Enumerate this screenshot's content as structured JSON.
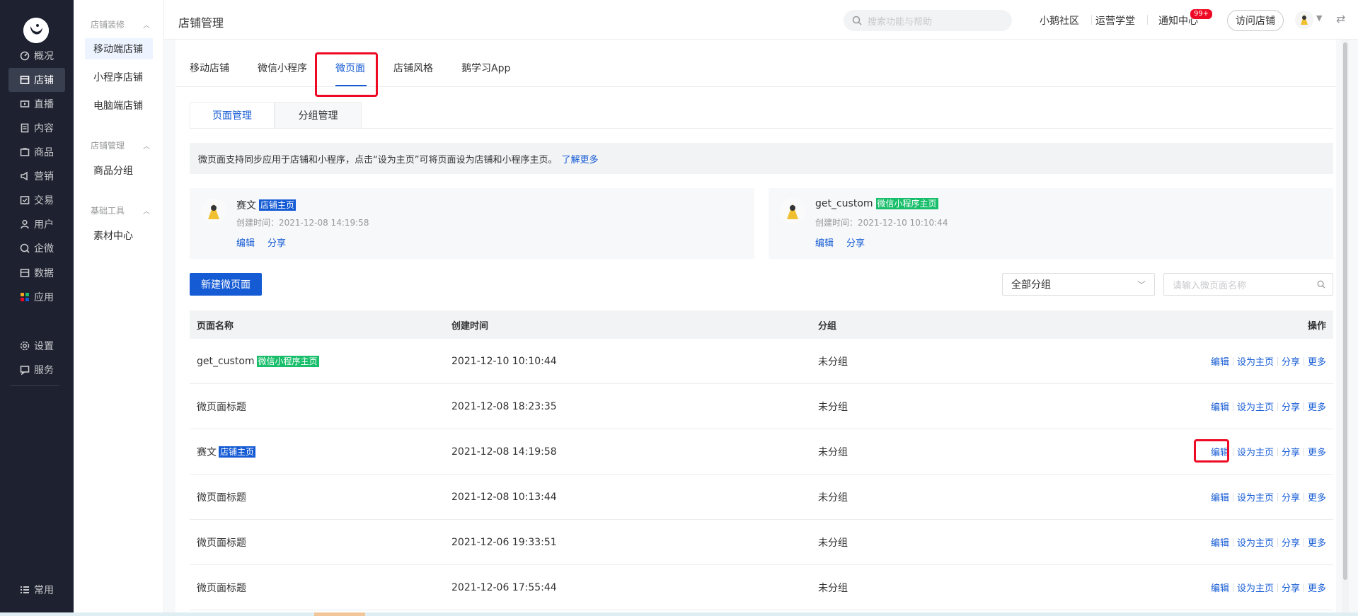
{
  "sidebar": {
    "items": [
      {
        "label": "概况",
        "icon": "overview-icon"
      },
      {
        "label": "店铺",
        "icon": "store-icon"
      },
      {
        "label": "直播",
        "icon": "live-icon"
      },
      {
        "label": "内容",
        "icon": "content-icon"
      },
      {
        "label": "商品",
        "icon": "goods-icon"
      },
      {
        "label": "营销",
        "icon": "marketing-icon"
      },
      {
        "label": "交易",
        "icon": "trade-icon"
      },
      {
        "label": "用户",
        "icon": "user-icon"
      },
      {
        "label": "企微",
        "icon": "wecom-icon"
      },
      {
        "label": "数据",
        "icon": "data-icon"
      },
      {
        "label": "应用",
        "icon": "apps-icon"
      },
      {
        "label": "设置",
        "icon": "settings-icon"
      },
      {
        "label": "服务",
        "icon": "service-icon"
      }
    ],
    "bottom": {
      "label": "常用",
      "icon": "list-icon"
    },
    "active_index": 1
  },
  "subnav": {
    "groups": [
      {
        "title": "店铺装修",
        "items": [
          "移动端店铺",
          "小程序店铺",
          "电脑端店铺"
        ]
      },
      {
        "title": "店铺管理",
        "items": [
          "商品分组"
        ]
      },
      {
        "title": "基础工具",
        "items": [
          "素材中心"
        ]
      }
    ],
    "active": "移动端店铺"
  },
  "header": {
    "title": "店铺管理",
    "search_placeholder": "搜索功能与帮助",
    "links": [
      "小鹅社区",
      "运营学堂",
      "通知中心"
    ],
    "notify_badge": "99+",
    "visit_store": "访问店铺"
  },
  "tabs": {
    "items": [
      "移动店铺",
      "微信小程序",
      "微页面",
      "店铺风格",
      "鹅学习App"
    ],
    "active": "微页面"
  },
  "subtabs": {
    "items": [
      "页面管理",
      "分组管理"
    ],
    "active": "页面管理"
  },
  "notice": {
    "text": "微页面支持同步应用于店铺和小程序，点击“设为主页”可将页面设为店铺和小程序主页。",
    "link": "了解更多"
  },
  "home_cards": [
    {
      "name": "赛文",
      "tag": "店铺主页",
      "tag_color": "#155bd4",
      "time": "创建时间：2021-12-08 14:19:58",
      "edit": "编辑",
      "share": "分享"
    },
    {
      "name": "get_custom",
      "tag": "微信小程序主页",
      "tag_color": "#19be6b",
      "time": "创建时间：2021-12-10 10:10:44",
      "edit": "编辑",
      "share": "分享"
    }
  ],
  "toolbar": {
    "new_page": "新建微页面",
    "group_select": "全部分组",
    "name_search_placeholder": "请输入微页面名称"
  },
  "table": {
    "headers": [
      "页面名称",
      "创建时间",
      "分组",
      "操作"
    ],
    "op_labels": [
      "编辑",
      "设为主页",
      "分享",
      "更多"
    ],
    "rows": [
      {
        "name": "get_custom",
        "tag": "微信小程序主页",
        "tag_color": "green",
        "time": "2021-12-10 10:10:44",
        "group": "未分组"
      },
      {
        "name": "微页面标题",
        "tag": "",
        "tag_color": "",
        "time": "2021-12-08 18:23:35",
        "group": "未分组"
      },
      {
        "name": "赛文",
        "tag": "店铺主页",
        "tag_color": "blue",
        "time": "2021-12-08 14:19:58",
        "group": "未分组"
      },
      {
        "name": "微页面标题",
        "tag": "",
        "tag_color": "",
        "time": "2021-12-08 10:13:44",
        "group": "未分组"
      },
      {
        "name": "微页面标题",
        "tag": "",
        "tag_color": "",
        "time": "2021-12-06 19:33:51",
        "group": "未分组"
      },
      {
        "name": "微页面标题",
        "tag": "",
        "tag_color": "",
        "time": "2021-12-06 17:55:44",
        "group": "未分组"
      }
    ]
  },
  "colors": {
    "sidebar_bg": "#1e2230",
    "accent": "#155bd4",
    "highlight": "#ee0a24",
    "tag_green": "#19be6b"
  }
}
